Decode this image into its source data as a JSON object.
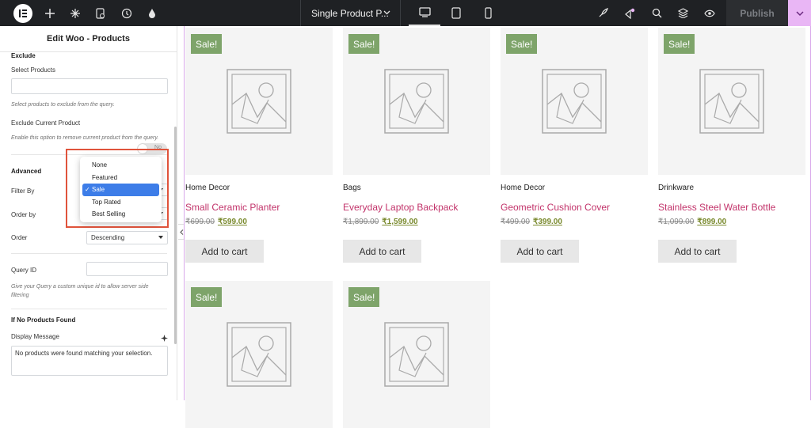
{
  "topbar": {
    "doc_title": "Single Product P...",
    "publish_label": "Publish"
  },
  "panel": {
    "title": "Edit Woo - Products",
    "exclude_heading": "Exclude",
    "select_products_label": "Select Products",
    "select_products_hint": "Select products to exclude from the query.",
    "exclude_current_label": "Exclude Current Product",
    "toggle_text": "No",
    "exclude_current_hint": "Enable this option to remove current product from the query.",
    "advanced_heading": "Advanced",
    "filter_by_label": "Filter By",
    "order_by_label": "Order by",
    "order_label": "Order",
    "order_value": "Descending",
    "query_id_label": "Query ID",
    "query_id_hint": "Give your Query a custom unique id to allow server side filtering",
    "no_products_heading": "If No Products Found",
    "display_message_label": "Display Message",
    "display_message_value": "No products were found matching your selection."
  },
  "dropdown": {
    "options": [
      "None",
      "Featured",
      "Sale",
      "Top Rated",
      "Best Selling"
    ],
    "selected": "Sale",
    "check": "✓"
  },
  "products": [
    {
      "badge": "Sale!",
      "category": "Home Decor",
      "title": "Small Ceramic Planter",
      "old_price": "₹699.00",
      "price": "₹599.00",
      "button": "Add to cart"
    },
    {
      "badge": "Sale!",
      "category": "Bags",
      "title": "Everyday Laptop Backpack",
      "old_price": "₹1,899.00",
      "price": "₹1,599.00",
      "button": "Add to cart"
    },
    {
      "badge": "Sale!",
      "category": "Home Decor",
      "title": "Geometric Cushion Cover",
      "old_price": "₹499.00",
      "price": "₹399.00",
      "button": "Add to cart"
    },
    {
      "badge": "Sale!",
      "category": "Drinkware",
      "title": "Stainless Steel Water Bottle",
      "old_price": "₹1,099.00",
      "price": "₹899.00",
      "button": "Add to cart"
    },
    {
      "badge": "Sale!"
    },
    {
      "badge": "Sale!"
    }
  ],
  "colors": {
    "topbar": "#1f2124",
    "sale_badge": "#7ea46a",
    "product_title": "#c2336a",
    "dropdown_selected": "#3d7de8",
    "highlight": "#e0533b"
  }
}
